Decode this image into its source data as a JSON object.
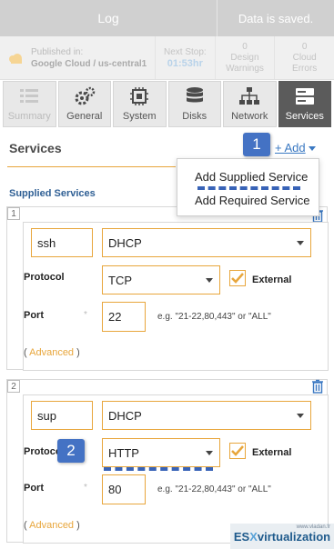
{
  "topbar": {
    "log_label": "Log",
    "saved_text": "Data is saved."
  },
  "status": {
    "published_label": "Published in:",
    "published_location": "Google Cloud / us-central1",
    "next_stop_label": "Next Stop:",
    "next_stop_value": "01:53hr",
    "design_warnings_count": "0",
    "design_warnings_label": "Design Warnings",
    "cloud_errors_count": "0",
    "cloud_errors_label": "Cloud Errors"
  },
  "tabs": [
    {
      "label": "Summary",
      "icon": "summary-icon"
    },
    {
      "label": "General",
      "icon": "gears-icon"
    },
    {
      "label": "System",
      "icon": "chip-icon"
    },
    {
      "label": "Disks",
      "icon": "database-icon"
    },
    {
      "label": "Network",
      "icon": "network-icon"
    },
    {
      "label": "Services",
      "icon": "server-icon",
      "active": true
    }
  ],
  "services": {
    "title": "Services",
    "add_label": "+ Add",
    "supplied_title": "Supplied Services",
    "menu": {
      "item1": "Add Supplied Service",
      "item2": "Add Required Service"
    }
  },
  "badges": {
    "b1": "1",
    "b2": "2"
  },
  "service1": {
    "number": "1",
    "name": "ssh",
    "type": "DHCP",
    "protocol_label": "Protocol",
    "protocol": "TCP",
    "external_label": "External",
    "port_label": "Port",
    "star": "*",
    "port": "22",
    "hint": "e.g. \"21-22,80,443\" or \"ALL\"",
    "adv_open": "( ",
    "adv_label": "Advanced",
    "adv_close": " )"
  },
  "service2": {
    "number": "2",
    "name": "sup",
    "type": "DHCP",
    "protocol_label": "Protocol",
    "protocol": "HTTP",
    "external_label": "External",
    "port_label": "Port",
    "star": "*",
    "port": "80",
    "hint": "e.g. \"21-22,80,443\" or \"ALL\"",
    "adv_open": "( ",
    "adv_label": "Advanced",
    "adv_close": " )"
  },
  "watermark": {
    "left": "ES",
    "x": "X",
    "right": "virtualization",
    "small": "www.vladan.fr"
  },
  "colors": {
    "accent": "#e8a63c",
    "link": "#3a78c2",
    "badge": "#4472c4",
    "active_tab": "#5b5b5b"
  }
}
